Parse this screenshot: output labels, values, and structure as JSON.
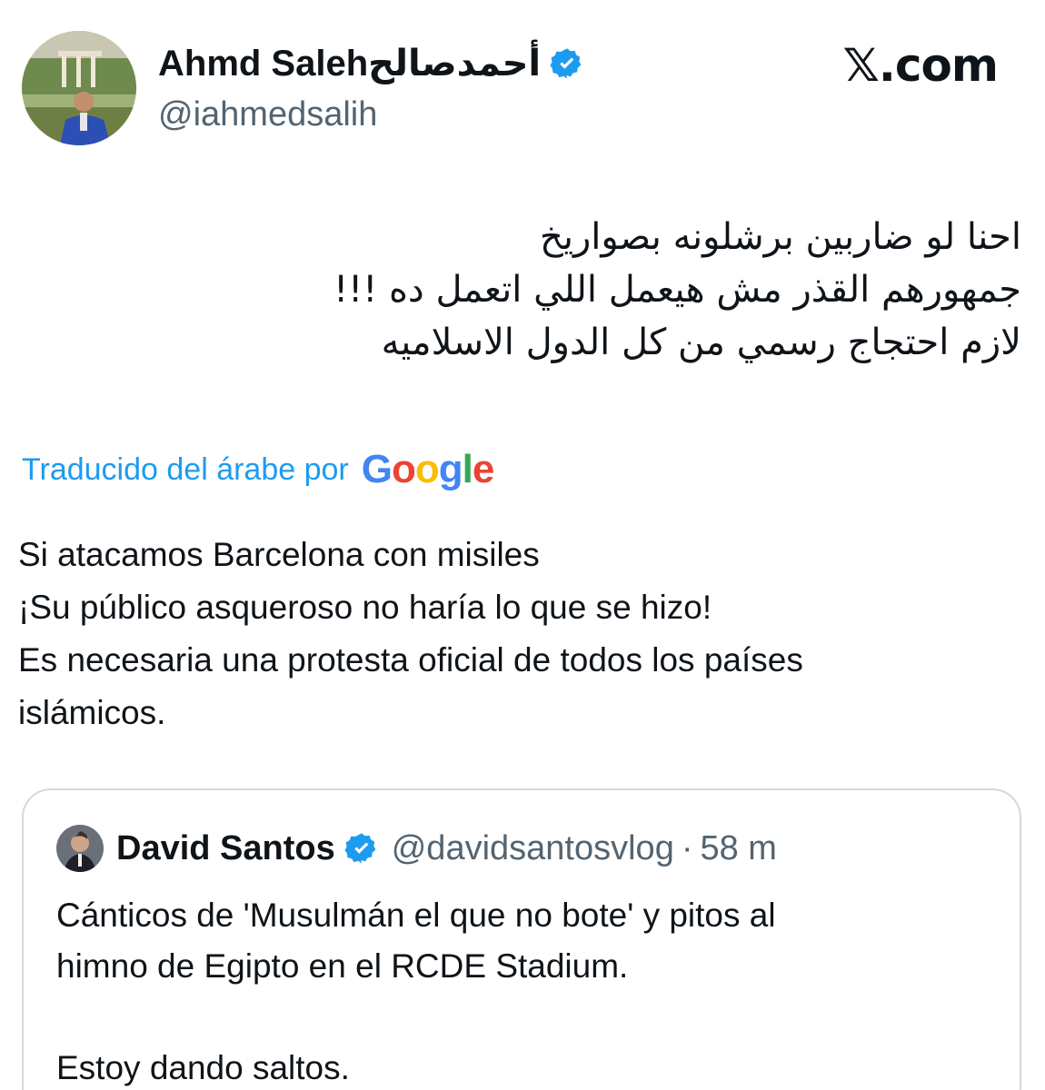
{
  "tweet": {
    "display_name": "Ahmd Salehأحمدصالح",
    "handle": "@iahmedsalih",
    "verified_icon": "verified-badge-icon",
    "source": "𝕏.com",
    "arabic_lines": [
      "احنا لو ضاربين برشلونه بصواريخ",
      "جمهورهم القذر مش هيعمل اللي اتعمل ده !!!",
      "لازم احتجاج رسمي من كل الدول الاسلاميه"
    ],
    "translated_label": "Traducido del árabe por",
    "google_logo_text": "Google",
    "translation_lines": [
      "Si atacamos Barcelona con misiles",
      "¡Su público asqueroso no haría lo que se hizo!",
      "Es necesaria una protesta oficial de todos los países",
      "islámicos."
    ]
  },
  "quoted": {
    "display_name": "David Santos",
    "handle": "@davidsantosvlog",
    "separator": "·",
    "time": "58 m",
    "text_lines": [
      "Cánticos de 'Musulmán el que no bote' y pitos al",
      "himno de Egipto en el RCDE Stadium.",
      "",
      "Estoy dando saltos."
    ]
  },
  "colors": {
    "accent": "#1d9bf0",
    "text": "#0f1419",
    "secondary": "#536471",
    "border": "#cfd9de"
  }
}
